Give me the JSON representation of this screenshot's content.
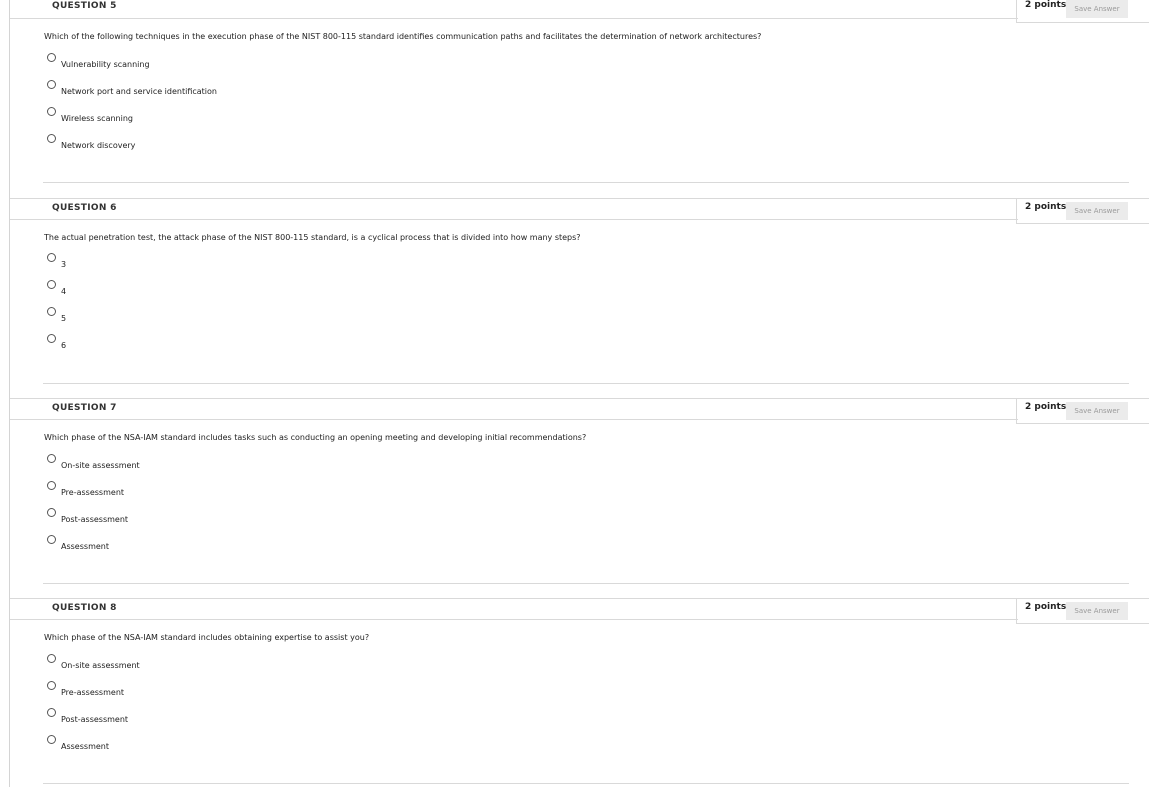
{
  "questions": [
    {
      "title": "QUESTION 5",
      "points": "2 points",
      "save_label": "Save Answer",
      "text": "Which of the following techniques in the execution phase of the NIST 800-115 standard identifies communication paths and facilitates the determination of network architectures?",
      "options": [
        "Vulnerability scanning",
        "Network port and service identification",
        "Wireless scanning",
        "Network discovery"
      ]
    },
    {
      "title": "QUESTION 6",
      "points": "2 points",
      "save_label": "Save Answer",
      "text": "The actual penetration test, the attack phase of the NIST 800-115 standard, is a cyclical process that is divided into how many steps?",
      "options": [
        "3",
        "4",
        "5",
        "6"
      ]
    },
    {
      "title": "QUESTION 7",
      "points": "2 points",
      "save_label": "Save Answer",
      "text": "Which phase of the NSA-IAM standard includes tasks such as conducting an opening meeting and developing initial recommendations?",
      "options": [
        "On-site assessment",
        "Pre-assessment",
        "Post-assessment",
        "Assessment"
      ]
    },
    {
      "title": "QUESTION 8",
      "points": "2 points",
      "save_label": "Save Answer",
      "text": "Which phase of the NSA-IAM standard includes obtaining expertise to assist you?",
      "options": [
        "On-site assessment",
        "Pre-assessment",
        "Post-assessment",
        "Assessment"
      ]
    }
  ]
}
